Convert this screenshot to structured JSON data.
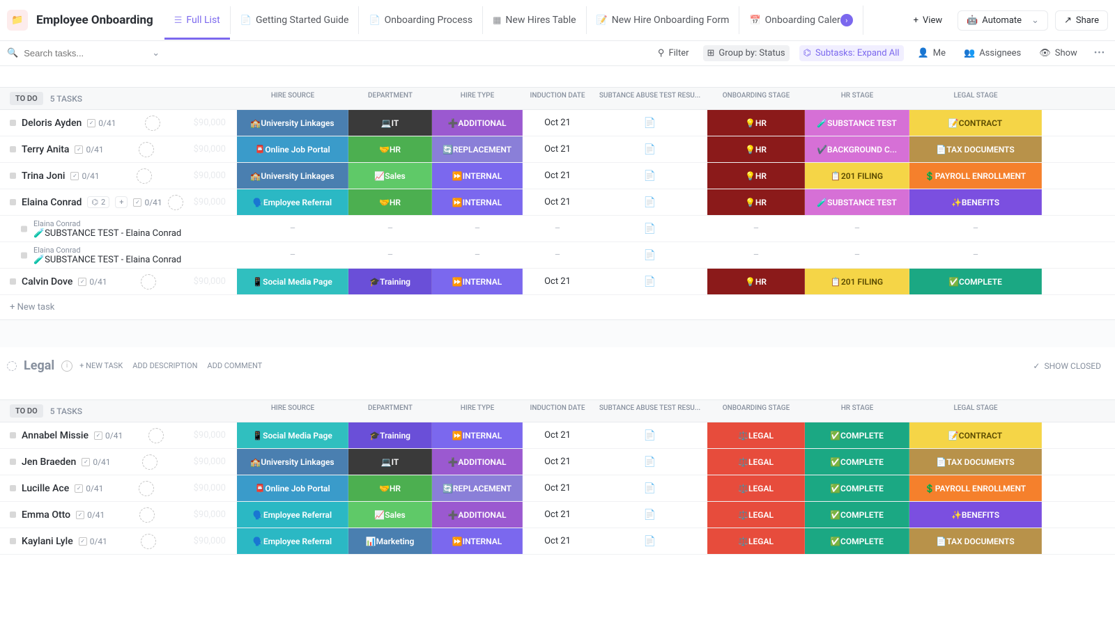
{
  "header": {
    "title": "Employee Onboarding",
    "tabs": [
      {
        "label": "Full List",
        "active": true
      },
      {
        "label": "Getting Started Guide"
      },
      {
        "label": "Onboarding Process"
      },
      {
        "label": "New Hires Table"
      },
      {
        "label": "New Hire Onboarding Form"
      },
      {
        "label": "Onboarding Caler",
        "truncated": true
      }
    ],
    "view_btn": "View",
    "automate_btn": "Automate",
    "share_btn": "Share"
  },
  "toolbar": {
    "search_placeholder": "Search tasks...",
    "filter": "Filter",
    "groupby": "Group by: Status",
    "subtasks": "Subtasks: Expand All",
    "me": "Me",
    "assignees": "Assignees",
    "show": "Show"
  },
  "columns": [
    "HIRE SOURCE",
    "DEPARTMENT",
    "HIRE TYPE",
    "INDUCTION DATE",
    "SUBTANCE ABUSE TEST RESU...",
    "ONBOARDING STAGE",
    "HR STAGE",
    "LEGAL STAGE"
  ],
  "group1": {
    "status": "TO DO",
    "count": "5 TASKS",
    "new_task": "+ New task",
    "rows": [
      {
        "name": "Deloris Ayden",
        "progress": "0/41",
        "price": "$90,000",
        "hire_source": {
          "t": "🏫University Linkages",
          "c": "c-univ"
        },
        "department": {
          "t": "💻IT",
          "c": "c-it"
        },
        "hire_type": {
          "t": "➕ADDITIONAL",
          "c": "c-additional"
        },
        "date": "Oct 21",
        "onboarding": {
          "t": "💡HR",
          "c": "c-hrstage"
        },
        "hr": {
          "t": "🧪SUBSTANCE TEST",
          "c": "c-substance"
        },
        "legal": {
          "t": "📝CONTRACT",
          "c": "c-contract"
        }
      },
      {
        "name": "Terry Anita",
        "progress": "0/41",
        "price": "$90,000",
        "hire_source": {
          "t": "📮Online Job Portal",
          "c": "c-portal"
        },
        "department": {
          "t": "🤝HR",
          "c": "c-hr"
        },
        "hire_type": {
          "t": "🔄REPLACEMENT",
          "c": "c-replacement"
        },
        "date": "Oct 21",
        "onboarding": {
          "t": "💡HR",
          "c": "c-hrstage"
        },
        "hr": {
          "t": "✔️BACKGROUND C...",
          "c": "c-background"
        },
        "legal": {
          "t": "📄TAX DOCUMENTS",
          "c": "c-tax"
        }
      },
      {
        "name": "Trina Joni",
        "progress": "0/41",
        "price": "$90,000",
        "hire_source": {
          "t": "🏫University Linkages",
          "c": "c-univ"
        },
        "department": {
          "t": "📈Sales",
          "c": "c-sales"
        },
        "hire_type": {
          "t": "⏩INTERNAL",
          "c": "c-internal"
        },
        "date": "Oct 21",
        "onboarding": {
          "t": "💡HR",
          "c": "c-hrstage"
        },
        "hr": {
          "t": "📋201 FILING",
          "c": "c-201"
        },
        "legal": {
          "t": "💲PAYROLL ENROLLMENT",
          "c": "c-payroll"
        }
      },
      {
        "name": "Elaina Conrad",
        "progress": "0/41",
        "price": "$90,000",
        "subtasks": "2",
        "hire_source": {
          "t": "🗣️Employee Referral",
          "c": "c-referral"
        },
        "department": {
          "t": "🤝HR",
          "c": "c-hr"
        },
        "hire_type": {
          "t": "⏩INTERNAL",
          "c": "c-internal"
        },
        "date": "Oct 21",
        "onboarding": {
          "t": "💡HR",
          "c": "c-hrstage"
        },
        "hr": {
          "t": "🧪SUBSTANCE TEST",
          "c": "c-substance"
        },
        "legal": {
          "t": "✨BENEFITS",
          "c": "c-benefits"
        }
      },
      {
        "name": "Calvin Dove",
        "progress": "0/41",
        "price": "$90,000",
        "hire_source": {
          "t": "📱Social Media Page",
          "c": "c-social"
        },
        "department": {
          "t": "🎓Training",
          "c": "c-training"
        },
        "hire_type": {
          "t": "⏩INTERNAL",
          "c": "c-internal"
        },
        "date": "Oct 21",
        "onboarding": {
          "t": "💡HR",
          "c": "c-hrstage"
        },
        "hr": {
          "t": "📋201 FILING",
          "c": "c-201"
        },
        "legal": {
          "t": "✅COMPLETE",
          "c": "c-complete-legal"
        }
      }
    ],
    "subrows": [
      {
        "parent": "Elaina Conrad",
        "name": "🧪SUBSTANCE TEST - Elaina Conrad"
      },
      {
        "parent": "Elaina Conrad",
        "name": "🧪SUBSTANCE TEST - Elaina Conrad"
      }
    ]
  },
  "group2": {
    "name": "Legal",
    "new_task": "+ NEW TASK",
    "add_desc": "ADD DESCRIPTION",
    "add_comment": "ADD COMMENT",
    "show_closed": "SHOW CLOSED",
    "status": "TO DO",
    "count": "5 TASKS",
    "rows": [
      {
        "name": "Annabel Missie",
        "progress": "0/41",
        "price": "$90,000",
        "hire_source": {
          "t": "📱Social Media Page",
          "c": "c-social"
        },
        "department": {
          "t": "🎓Training",
          "c": "c-training"
        },
        "hire_type": {
          "t": "⏩INTERNAL",
          "c": "c-internal"
        },
        "date": "Oct 21",
        "onboarding": {
          "t": "⚖️LEGAL",
          "c": "c-legal"
        },
        "hr": {
          "t": "✅COMPLETE",
          "c": "c-complete-hr"
        },
        "legal": {
          "t": "📝CONTRACT",
          "c": "c-contract"
        }
      },
      {
        "name": "Jen Braeden",
        "progress": "0/41",
        "price": "$90,000",
        "hire_source": {
          "t": "🏫University Linkages",
          "c": "c-univ"
        },
        "department": {
          "t": "💻IT",
          "c": "c-it"
        },
        "hire_type": {
          "t": "➕ADDITIONAL",
          "c": "c-additional"
        },
        "date": "Oct 21",
        "onboarding": {
          "t": "⚖️LEGAL",
          "c": "c-legal"
        },
        "hr": {
          "t": "✅COMPLETE",
          "c": "c-complete-hr"
        },
        "legal": {
          "t": "📄TAX DOCUMENTS",
          "c": "c-tax"
        }
      },
      {
        "name": "Lucille Ace",
        "progress": "0/41",
        "price": "$90,000",
        "hire_source": {
          "t": "📮Online Job Portal",
          "c": "c-portal"
        },
        "department": {
          "t": "🤝HR",
          "c": "c-hr"
        },
        "hire_type": {
          "t": "🔄REPLACEMENT",
          "c": "c-replacement"
        },
        "date": "Oct 21",
        "onboarding": {
          "t": "⚖️LEGAL",
          "c": "c-legal"
        },
        "hr": {
          "t": "✅COMPLETE",
          "c": "c-complete-hr"
        },
        "legal": {
          "t": "💲PAYROLL ENROLLMENT",
          "c": "c-payroll"
        }
      },
      {
        "name": "Emma Otto",
        "progress": "0/41",
        "price": "$90,000",
        "hire_source": {
          "t": "🗣️Employee Referral",
          "c": "c-referral"
        },
        "department": {
          "t": "📈Sales",
          "c": "c-sales"
        },
        "hire_type": {
          "t": "➕ADDITIONAL",
          "c": "c-additional"
        },
        "date": "Oct 21",
        "onboarding": {
          "t": "⚖️LEGAL",
          "c": "c-legal"
        },
        "hr": {
          "t": "✅COMPLETE",
          "c": "c-complete-hr"
        },
        "legal": {
          "t": "✨BENEFITS",
          "c": "c-benefits"
        }
      },
      {
        "name": "Kaylani Lyle",
        "progress": "0/41",
        "price": "$90,000",
        "hire_source": {
          "t": "🗣️Employee Referral",
          "c": "c-referral"
        },
        "department": {
          "t": "📊Marketing",
          "c": "c-marketing"
        },
        "hire_type": {
          "t": "⏩INTERNAL",
          "c": "c-internal"
        },
        "date": "Oct 21",
        "onboarding": {
          "t": "⚖️LEGAL",
          "c": "c-legal"
        },
        "hr": {
          "t": "✅COMPLETE",
          "c": "c-complete-hr"
        },
        "legal": {
          "t": "📄TAX DOCUMENTS",
          "c": "c-tax"
        }
      }
    ]
  }
}
